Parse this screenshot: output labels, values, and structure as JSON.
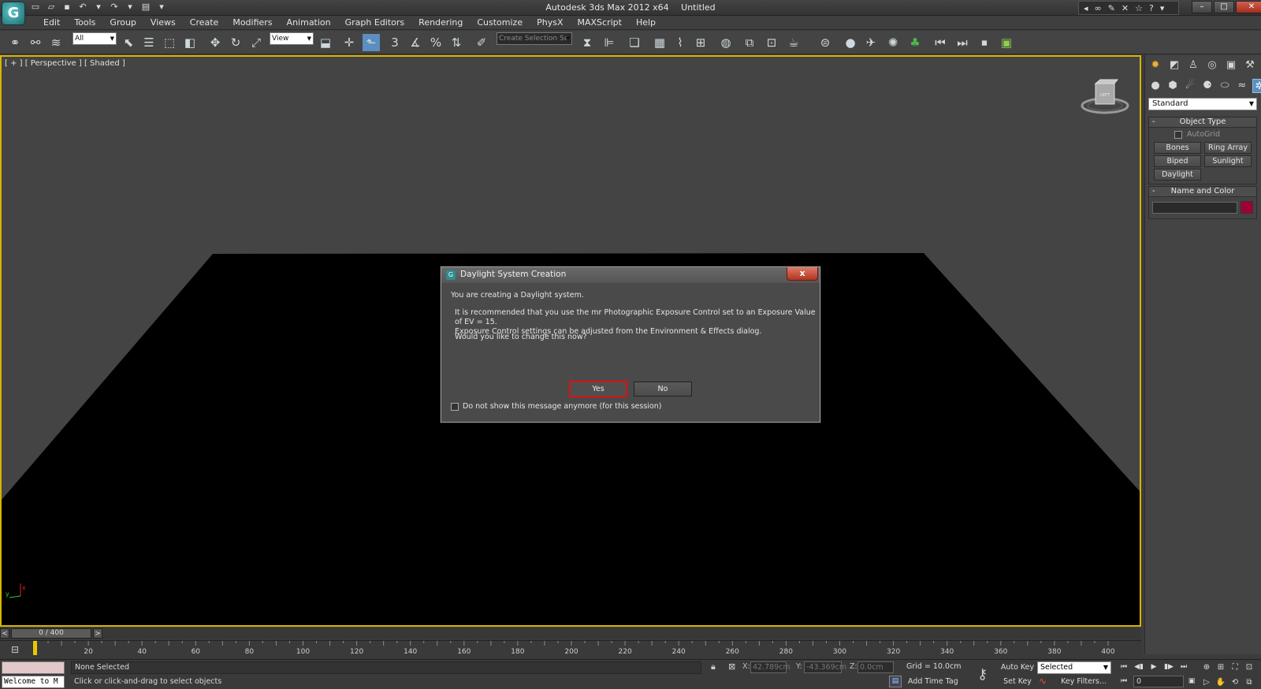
{
  "window": {
    "app_name": "Autodesk 3ds Max  2012 x64",
    "document": "Untitled",
    "logo_letter": "G"
  },
  "menus": [
    "Edit",
    "Tools",
    "Group",
    "Views",
    "Create",
    "Modifiers",
    "Animation",
    "Graph Editors",
    "Rendering",
    "Customize",
    "PhysX",
    "MAXScript",
    "Help"
  ],
  "toolbar": {
    "selection_filter": "All",
    "reference_coord": "View",
    "named_selection_placeholder": "Create Selection Se",
    "snap_3": "3",
    "snap_percent": "%"
  },
  "viewport": {
    "label": "[ + ] [ Perspective ] [ Shaded ]",
    "viewcube_face": "LEFT",
    "axis_y": "y",
    "axis_x": "x",
    "ground_color": "#000000",
    "border_color": "#d8b400"
  },
  "command_panel": {
    "category": "Standard",
    "object_type_title": "Object Type",
    "autogrid": "AutoGrid",
    "buttons": [
      "Bones",
      "Ring Array",
      "Biped",
      "Sunlight",
      "Daylight"
    ],
    "name_color_title": "Name and Color",
    "object_color": "#a0003a",
    "minus": "-"
  },
  "time_slider": {
    "position": "0 / 400",
    "left_arrow": "<",
    "right_arrow": ">"
  },
  "track_ticks": [
    "20",
    "40",
    "60",
    "80",
    "100",
    "120",
    "140",
    "160",
    "180",
    "200",
    "220",
    "240",
    "260",
    "280",
    "300",
    "320",
    "340",
    "360",
    "380",
    "400"
  ],
  "status": {
    "listener_text": "Welcome to M",
    "selection": "None Selected",
    "prompt": "Click or click-and-drag to select objects",
    "x_label": "X:",
    "x_value": "42.789cm",
    "y_label": "Y:",
    "y_value": "-43.369cm",
    "z_label": "Z:",
    "z_value": "0.0cm",
    "grid": "Grid = 10.0cm",
    "add_time_tag": "Add Time Tag",
    "auto_key": "Auto Key",
    "set_key": "Set Key",
    "key_mode": "Selected",
    "key_filters": "Key Filters...",
    "current_frame": "0"
  },
  "dialog": {
    "title": "Daylight System Creation",
    "close_glyph": "x",
    "line1": "You are creating a Daylight system.",
    "line2": "It is recommended that you use the mr Photographic Exposure Control set to an Exposure Value of EV = 15.\nExposure Control settings can be adjusted from the Environment & Effects dialog.",
    "line3": "Would you like to change this now?",
    "yes_label": "Yes",
    "no_label": "No",
    "checkbox_label": "Do not show this message anymore (for this session)",
    "highlight_color": "#dd1111"
  }
}
